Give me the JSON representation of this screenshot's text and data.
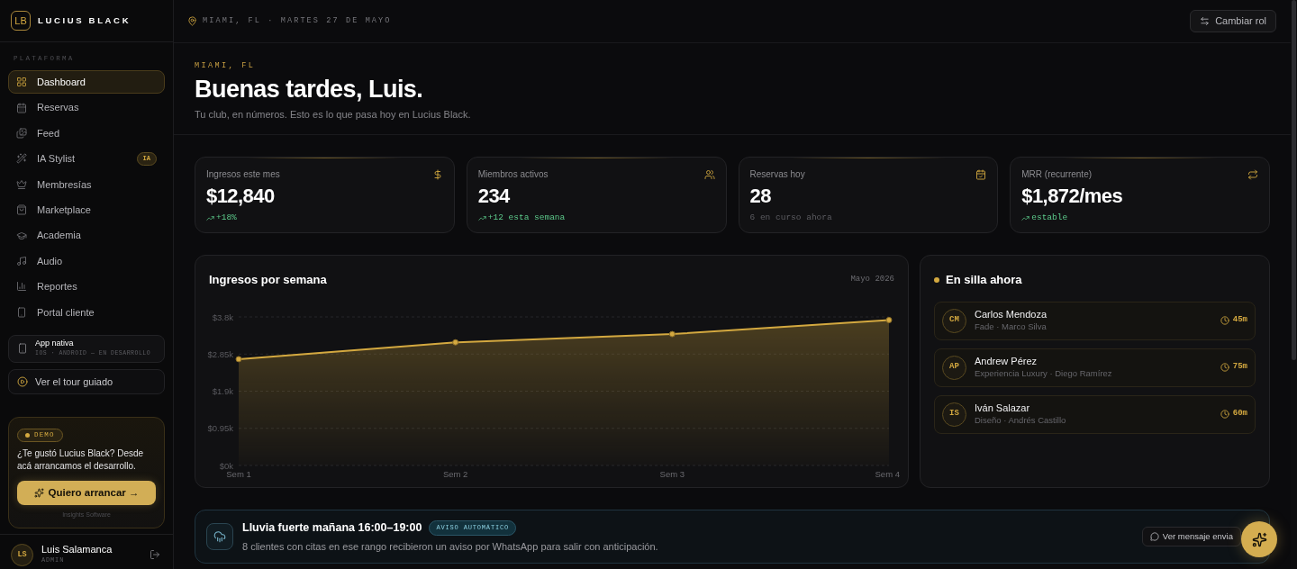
{
  "sidebar": {
    "logo": {
      "initials": "LB",
      "name": "LUCIUS BLACK"
    },
    "section_label": "PLATAFORMA",
    "items": [
      {
        "label": "Dashboard",
        "selected": true
      },
      {
        "label": "Reservas",
        "selected": false
      },
      {
        "label": "Feed",
        "selected": false
      },
      {
        "label": "IA Stylist",
        "selected": false,
        "badge": "IA"
      },
      {
        "label": "Membresías",
        "selected": false
      },
      {
        "label": "Marketplace",
        "selected": false
      },
      {
        "label": "Academia",
        "selected": false
      },
      {
        "label": "Audio",
        "selected": false
      },
      {
        "label": "Reportes",
        "selected": false
      },
      {
        "label": "Portal cliente",
        "selected": false
      }
    ],
    "app_card": {
      "title": "App nativa",
      "subtitle": "IOS · ANDROID — EN DESARROLLO"
    },
    "tour_link": {
      "label": "Ver el tour guiado"
    },
    "demo_card": {
      "badge": "DEMO",
      "text": "¿Te gustó Lucius Black? Desde acá arrancamos el desarrollo.",
      "button": "Quiero arrancar →",
      "footer": "Insights Software"
    },
    "user": {
      "initials": "LS",
      "name": "Luis Salamanca",
      "role": "ADMIN"
    }
  },
  "header": {
    "location": "MIAMI, FL · MARTES 27 DE MAYO",
    "button": "Cambiar rol"
  },
  "hero": {
    "eyebrow": "MIAMI, FL",
    "title": "Buenas tardes, Luis.",
    "subtitle": "Tu club, en números. Esto es lo que pasa hoy en Lucius Black."
  },
  "kpis": [
    {
      "label": "Ingresos este mes",
      "value": "$12,840",
      "foot": {
        "kind": "trend",
        "text": "+18%"
      }
    },
    {
      "label": "Miembros activos",
      "value": "234",
      "foot": {
        "kind": "trend",
        "text": "+12 esta semana"
      }
    },
    {
      "label": "Reservas hoy",
      "value": "28",
      "foot": {
        "kind": "note",
        "text": "6 en curso ahora"
      }
    },
    {
      "label": "MRR (recurrente)",
      "value": "$1,872/mes",
      "foot": {
        "kind": "trend",
        "text": "estable"
      }
    }
  ],
  "revenue_chart": {
    "period": "Mayo 2026",
    "chart_data": {
      "type": "area",
      "title": "Ingresos por semana",
      "categories": [
        "Sem 1",
        "Sem 2",
        "Sem 3",
        "Sem 4"
      ],
      "values": [
        2720,
        3150,
        3360,
        3720
      ],
      "ylim": [
        0,
        3800
      ],
      "yticks": [
        {
          "value": 0,
          "label": "$0k"
        },
        {
          "value": 950,
          "label": "$0.95k"
        },
        {
          "value": 1900,
          "label": "$1.9k"
        },
        {
          "value": 2850,
          "label": "$2.85k"
        },
        {
          "value": 3800,
          "label": "$3.8k"
        }
      ],
      "grid": true
    }
  },
  "in_chair": {
    "title": "En silla ahora",
    "clients": [
      {
        "initials": "CM",
        "name": "Carlos Mendoza",
        "detail": "Fade · Marco Silva",
        "duration": "45m"
      },
      {
        "initials": "AP",
        "name": "Andrew Pérez",
        "detail": "Experiencia Luxury · Diego Ramírez",
        "duration": "75m"
      },
      {
        "initials": "IS",
        "name": "Iván Salazar",
        "detail": "Diseño · Andrés Castillo",
        "duration": "60m"
      }
    ]
  },
  "alert": {
    "title": "Lluvia fuerte mañana 16:00–19:00",
    "badge": "AVISO AUTOMÁTICO",
    "text": "8 clientes con citas en ese rango recibieron un aviso por WhatsApp para salir con anticipación.",
    "button": "Ver mensaje envia"
  }
}
